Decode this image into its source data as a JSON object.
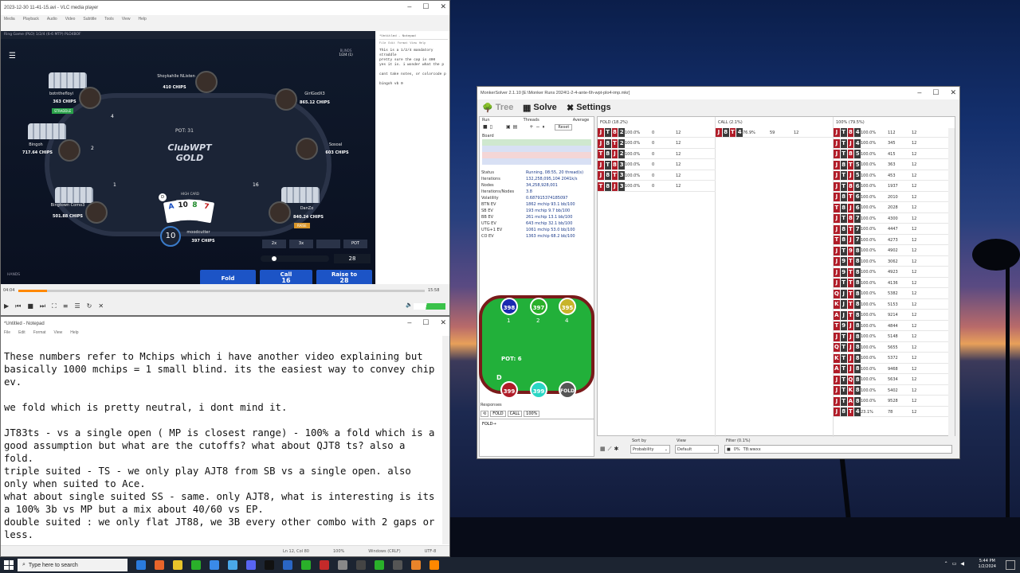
{
  "vlc": {
    "title": "2023-12-30 11-41-15.avi - VLC media player",
    "menu": [
      "Media",
      "Playback",
      "Audio",
      "Video",
      "Subtitle",
      "Tools",
      "View",
      "Help"
    ],
    "time_current": "04:04",
    "time_total": "15:58",
    "progress": 0.07
  },
  "poker": {
    "title": "Ring Game (PLO) 1/2/4 (6-6 MTP) PLO4BOF",
    "blinds_label": "BLINDS",
    "blinds": "1/2/4 (1)",
    "pot_label": "POT:",
    "pot": "31",
    "logo_line1": "ClubWPT",
    "logo_line2": "GOLD",
    "hand_label": "HIGH CARD",
    "hands_label": "HANDS",
    "players": [
      {
        "name": "botnthefloyi",
        "chips": "363 CHIPS",
        "tag": "STRADDLE"
      },
      {
        "name": "Shoykahlle NListen",
        "chips": "410 CHIPS"
      },
      {
        "name": "GirlGodX3",
        "chips": "865.12 CHIPS"
      },
      {
        "name": "Bingoh",
        "chips": "717.64 CHIPS"
      },
      {
        "name": "Sosoal",
        "chips": "603 CHIPS"
      },
      {
        "name": "Bingtown Como3",
        "chips": "501.88 CHIPS"
      },
      {
        "name": "DanZo",
        "chips": "840.24 CHIPS",
        "tag": "RAISE"
      },
      {
        "name": "moodcutter",
        "chips": "397 CHIPS"
      }
    ],
    "bets": [
      "4",
      "2",
      "1",
      "16",
      "10"
    ],
    "hole_cards": [
      "A",
      "10",
      "8",
      "7"
    ],
    "presets": [
      "2x",
      "3x",
      "",
      "POT"
    ],
    "raise_value": "28",
    "buttons": {
      "fold": "Fold",
      "call": "Call",
      "call_amt": "16",
      "raise": "Raise to",
      "raise_amt": "28"
    }
  },
  "side_notepad": {
    "title": "*Untitled - Notepad",
    "menu": [
      "File",
      "Edit",
      "Format",
      "View",
      "Help"
    ],
    "lines": [
      "This is a 1/2/4 mandatory straddle",
      "pretty sure the cap is 400",
      "yes it is. i wonder what the p",
      "",
      "cant take notes, or colorcode p",
      "",
      "bingoh   vb 0"
    ]
  },
  "notepad": {
    "title": "*Untitled - Notepad",
    "menu": [
      "File",
      "Edit",
      "Format",
      "View",
      "Help"
    ],
    "text": "These numbers refer to Mchips which i have another video explaining but\nbasically 1000 mchips = 1 small blind. its the easiest way to convey chip\nev.\n\nwe fold which is pretty neutral, i dont mind it.\n\nJT83ts - vs a single open ( MP is closest range) - 100% a fold which is a\ngood assumption but what are the cutoffs? what about QJT8 ts? also a\nfold.\ntriple suited - TS - we only play AJT8 from SB vs a single open. also\nonly when suited to Ace.\nwhat about single suited SS - same. only AJT8, what is interesting is its\na 100% 3b vs MP but a mix about 40/60 vs EP.\ndouble suited : we only flat JT88, we 3B every other combo with 2 gaps or\nless.",
    "status": [
      "Ln 12, Col 80",
      "100%",
      "Windows (CRLF)",
      "UTF-8"
    ]
  },
  "monker": {
    "title": "MonkerSolver 2.1.10 [E:\\Monker Runs 2024\\1-2-4-ante-6h-wpt-plo4-imp.mkr]",
    "tabs": [
      "Tree",
      "Solve",
      "Settings"
    ],
    "run_label": "Run",
    "threads_label": "Threads",
    "average_label": "Average",
    "reset_label": "Reset",
    "board_label": "Board",
    "stats": [
      [
        "Status",
        "Running, 08:55, 20 thread(s)"
      ],
      [
        "Iterations",
        "132,258,095,104  2041k/s"
      ],
      [
        "Nodes",
        "34,258,928,001"
      ],
      [
        "Iterations/Nodes",
        "3.8"
      ],
      [
        "Volatility",
        "0.687915374185097"
      ],
      [
        "BTN EV",
        "1862 mchip   93.1 bb/100"
      ],
      [
        "SB EV",
        "193 mchip   9.7 bb/100"
      ],
      [
        "BB EV",
        "261 mchip   13.1 bb/100"
      ],
      [
        "UTG EV",
        "643 mchip   32.1 bb/100"
      ],
      [
        "UTG+1 EV",
        "1061 mchip   53.0 bb/100"
      ],
      [
        "CO EV",
        "1363 mchip   68.2 bb/100"
      ]
    ],
    "felt": {
      "top_stacks": [
        "398",
        "397",
        "395"
      ],
      "top_seats": [
        "1",
        "2",
        "4"
      ],
      "pot": "POT: 6",
      "dealer": "D",
      "bottom_stacks": [
        "399",
        "399"
      ],
      "fold": "FOLD"
    },
    "responses_label": "Responses",
    "responses": [
      "FOLD",
      "CALL",
      "100%"
    ],
    "response_text": "FOLD→",
    "col_headers": [
      "FOLD (18.2%)",
      "CALL (2.1%)",
      "100% (79.5%)"
    ],
    "fold_rows": [
      {
        "cards": [
          "J",
          "T",
          "8",
          "2"
        ],
        "freq": "100.0%",
        "ev": "0",
        "c": "12"
      },
      {
        "cards": [
          "J",
          "8",
          "T",
          "2"
        ],
        "freq": "100.0%",
        "ev": "0",
        "c": "12"
      },
      {
        "cards": [
          "T",
          "8",
          "J",
          "2"
        ],
        "freq": "100.0%",
        "ev": "0",
        "c": "12"
      },
      {
        "cards": [
          "J",
          "T",
          "8",
          "3"
        ],
        "freq": "100.0%",
        "ev": "0",
        "c": "12"
      },
      {
        "cards": [
          "J",
          "8",
          "T",
          "3"
        ],
        "freq": "100.0%",
        "ev": "0",
        "c": "12"
      },
      {
        "cards": [
          "T",
          "8",
          "J",
          "3"
        ],
        "freq": "100.0%",
        "ev": "0",
        "c": "12"
      }
    ],
    "call_rows": [
      {
        "cards": [
          "J",
          "8",
          "T",
          "4"
        ],
        "freq": "76.9%",
        "ev": "59",
        "c": "12"
      }
    ],
    "raise_rows": [
      {
        "cards": [
          "J",
          "T",
          "8",
          "4"
        ],
        "freq": "100.0%",
        "ev": "112",
        "c": "12"
      },
      {
        "cards": [
          "J",
          "T",
          "J",
          "4"
        ],
        "freq": "100.0%",
        "ev": "345",
        "c": "12"
      },
      {
        "cards": [
          "J",
          "T",
          "8",
          "5"
        ],
        "freq": "100.0%",
        "ev": "415",
        "c": "12"
      },
      {
        "cards": [
          "J",
          "8",
          "T",
          "5"
        ],
        "freq": "100.0%",
        "ev": "363",
        "c": "12"
      },
      {
        "cards": [
          "J",
          "T",
          "J",
          "5"
        ],
        "freq": "100.0%",
        "ev": "453",
        "c": "12"
      },
      {
        "cards": [
          "J",
          "T",
          "8",
          "6"
        ],
        "freq": "100.0%",
        "ev": "1937",
        "c": "12"
      },
      {
        "cards": [
          "J",
          "8",
          "T",
          "6"
        ],
        "freq": "100.0%",
        "ev": "2010",
        "c": "12"
      },
      {
        "cards": [
          "T",
          "8",
          "J",
          "6"
        ],
        "freq": "100.0%",
        "ev": "2028",
        "c": "12"
      },
      {
        "cards": [
          "J",
          "T",
          "8",
          "7"
        ],
        "freq": "100.0%",
        "ev": "4300",
        "c": "12"
      },
      {
        "cards": [
          "J",
          "8",
          "T",
          "7"
        ],
        "freq": "100.0%",
        "ev": "4447",
        "c": "12"
      },
      {
        "cards": [
          "T",
          "8",
          "J",
          "7"
        ],
        "freq": "100.0%",
        "ev": "4273",
        "c": "12"
      },
      {
        "cards": [
          "J",
          "T",
          "9",
          "8"
        ],
        "freq": "100.0%",
        "ev": "4902",
        "c": "12"
      },
      {
        "cards": [
          "J",
          "9",
          "T",
          "8"
        ],
        "freq": "100.0%",
        "ev": "3062",
        "c": "12"
      },
      {
        "cards": [
          "J",
          "9",
          "T",
          "8"
        ],
        "freq": "100.0%",
        "ev": "4923",
        "c": "12"
      },
      {
        "cards": [
          "J",
          "T",
          "T",
          "8"
        ],
        "freq": "100.0%",
        "ev": "4136",
        "c": "12"
      },
      {
        "cards": [
          "Q",
          "J",
          "T",
          "8"
        ],
        "freq": "100.0%",
        "ev": "5382",
        "c": "12"
      },
      {
        "cards": [
          "K",
          "J",
          "T",
          "8"
        ],
        "freq": "100.0%",
        "ev": "5153",
        "c": "12"
      },
      {
        "cards": [
          "A",
          "J",
          "T",
          "8"
        ],
        "freq": "100.0%",
        "ev": "9214",
        "c": "12"
      },
      {
        "cards": [
          "T",
          "9",
          "J",
          "8"
        ],
        "freq": "100.0%",
        "ev": "4844",
        "c": "12"
      },
      {
        "cards": [
          "J",
          "T",
          "J",
          "8"
        ],
        "freq": "100.0%",
        "ev": "5148",
        "c": "12"
      },
      {
        "cards": [
          "Q",
          "T",
          "J",
          "8"
        ],
        "freq": "100.0%",
        "ev": "5655",
        "c": "12"
      },
      {
        "cards": [
          "K",
          "T",
          "J",
          "8"
        ],
        "freq": "100.0%",
        "ev": "5372",
        "c": "12"
      },
      {
        "cards": [
          "A",
          "T",
          "J",
          "8"
        ],
        "freq": "100.0%",
        "ev": "9468",
        "c": "12"
      },
      {
        "cards": [
          "J",
          "T",
          "Q",
          "8"
        ],
        "freq": "100.0%",
        "ev": "5634",
        "c": "12"
      },
      {
        "cards": [
          "J",
          "T",
          "K",
          "8"
        ],
        "freq": "100.0%",
        "ev": "5402",
        "c": "12"
      },
      {
        "cards": [
          "J",
          "T",
          "A",
          "8"
        ],
        "freq": "100.0%",
        "ev": "9528",
        "c": "12"
      },
      {
        "cards": [
          "J",
          "8",
          "T",
          "4"
        ],
        "freq": "23.1%",
        "ev": "78",
        "c": "12"
      }
    ],
    "sort_by_label": "Sort by",
    "sort_by": "Probability",
    "view_label": "View",
    "view": "Default",
    "filter_label": "Filter (0.1%)",
    "filter_pct": "0%",
    "filter_value": "T8:wwxx"
  },
  "taskbar": {
    "search_placeholder": "Type here to search",
    "time": "5:44 PM",
    "date": "1/2/2024"
  }
}
